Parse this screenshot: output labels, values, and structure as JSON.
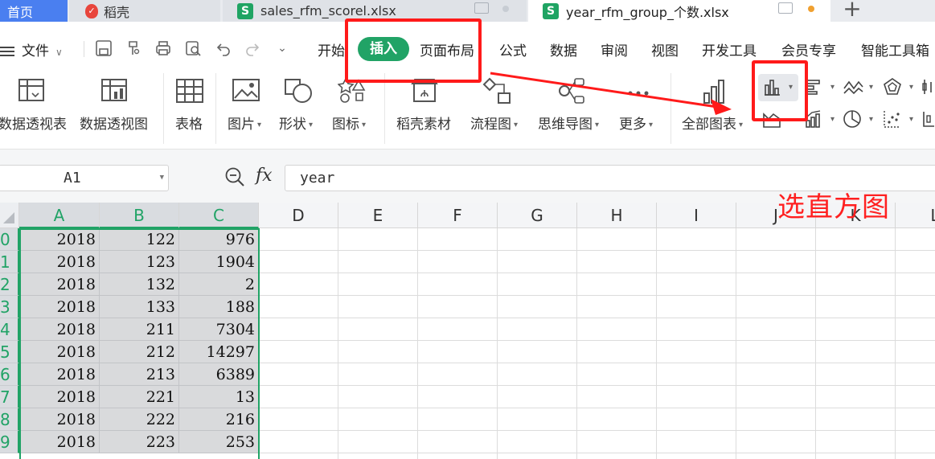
{
  "tabs": [
    {
      "label": "首页",
      "active": true
    },
    {
      "label": "稻壳",
      "icon": "daoke-logo-icon"
    },
    {
      "label": "sales_rfm_scorel.xlsx",
      "icon": "spreadsheet-icon"
    },
    {
      "label": "year_rfm_group_个数.xlsx",
      "icon": "spreadsheet-icon",
      "current": true
    }
  ],
  "add_tab": "+",
  "menu": {
    "file": "文件",
    "items": [
      "开始",
      "插入",
      "页面布局",
      "公式",
      "数据",
      "审阅",
      "视图",
      "开发工具",
      "会员专享",
      "智能工具箱"
    ],
    "active": "插入"
  },
  "ribbon": {
    "pivot_table": "数据透视表",
    "pivot_chart": "数据透视图",
    "table": "表格",
    "picture": "图片",
    "shape": "形状",
    "icons": "图标",
    "daoke_material": "稻壳素材",
    "flowchart": "流程图",
    "mindmap": "思维导图",
    "more": "更多",
    "all_charts": "全部图表"
  },
  "formula_bar": {
    "cell_ref": "A1",
    "fx": "fx",
    "value": "year"
  },
  "columns": [
    "A",
    "B",
    "C",
    "D",
    "E",
    "F",
    "G",
    "H",
    "I",
    "J",
    "K",
    "L"
  ],
  "rows": [
    {
      "idx": "0",
      "a": "2018",
      "b": "122",
      "c": "976"
    },
    {
      "idx": "1",
      "a": "2018",
      "b": "123",
      "c": "1904"
    },
    {
      "idx": "2",
      "a": "2018",
      "b": "132",
      "c": "2"
    },
    {
      "idx": "3",
      "a": "2018",
      "b": "133",
      "c": "188"
    },
    {
      "idx": "4",
      "a": "2018",
      "b": "211",
      "c": "7304"
    },
    {
      "idx": "5",
      "a": "2018",
      "b": "212",
      "c": "14297"
    },
    {
      "idx": "6",
      "a": "2018",
      "b": "213",
      "c": "6389"
    },
    {
      "idx": "7",
      "a": "2018",
      "b": "221",
      "c": "13"
    },
    {
      "idx": "8",
      "a": "2018",
      "b": "222",
      "c": "216"
    },
    {
      "idx": "9",
      "a": "2018",
      "b": "223",
      "c": "253"
    }
  ],
  "annotation": "选直方图",
  "colors": {
    "accent": "#21a366",
    "tab_home": "#4a7ff0",
    "annotation": "#ff1a1a",
    "selection_fill": "#d9dadc"
  }
}
